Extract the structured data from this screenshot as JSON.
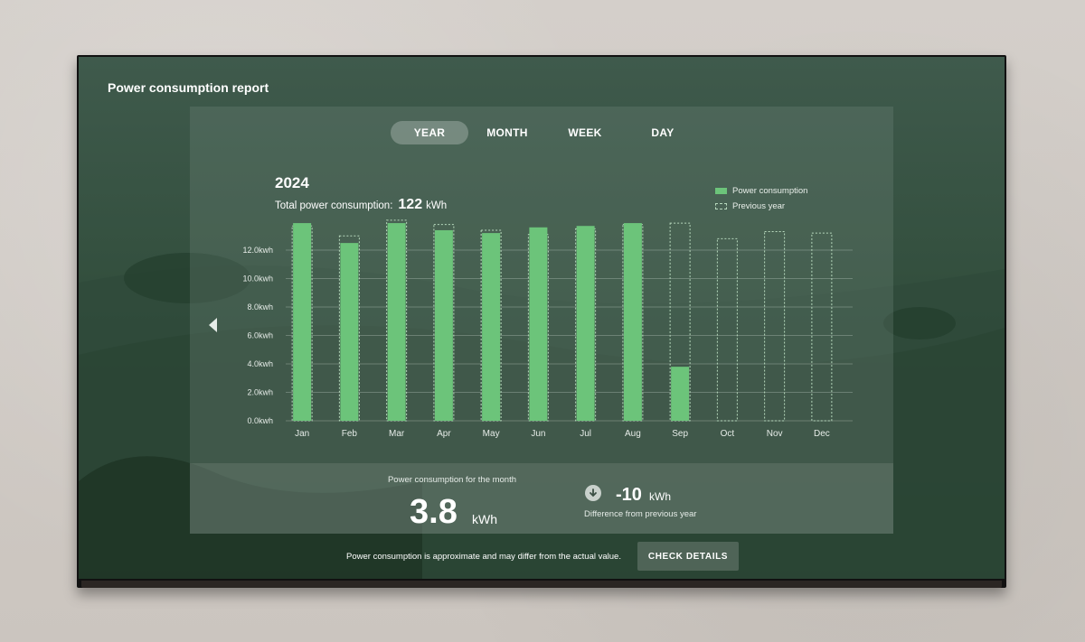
{
  "screen_title": "Power consumption report",
  "tabs": [
    {
      "label": "YEAR",
      "active": true
    },
    {
      "label": "MONTH",
      "active": false
    },
    {
      "label": "WEEK",
      "active": false
    },
    {
      "label": "DAY",
      "active": false
    }
  ],
  "period": {
    "year": "2024",
    "total_label": "Total power consumption:",
    "total_value": "122",
    "total_unit": "kWh"
  },
  "legend": {
    "current": "Power consumption",
    "previous": "Previous year"
  },
  "colors": {
    "bar": "#6cc47a",
    "previous_outline": "#b7d9bd",
    "grid": "rgba(220,230,224,0.28)"
  },
  "chart_data": {
    "type": "bar",
    "categories": [
      "Jan",
      "Feb",
      "Mar",
      "Apr",
      "May",
      "Jun",
      "Jul",
      "Aug",
      "Sep",
      "Oct",
      "Nov",
      "Dec"
    ],
    "series": [
      {
        "name": "Power consumption",
        "values": [
          13.9,
          12.5,
          13.9,
          13.4,
          13.2,
          13.6,
          13.7,
          13.9,
          3.8,
          null,
          null,
          null
        ]
      },
      {
        "name": "Previous year",
        "values": [
          13.7,
          13.0,
          14.1,
          13.8,
          13.4,
          13.1,
          13.5,
          13.8,
          13.9,
          12.8,
          13.3,
          13.2
        ]
      }
    ],
    "yticks": [
      "0.0kwh",
      "2.0kwh",
      "4.0kwh",
      "6.0kwh",
      "8.0kwh",
      "10.0kwh",
      "12.0kwh"
    ],
    "ylim": [
      0,
      12
    ],
    "grid": true,
    "legend_position": "top-right"
  },
  "month_summary": {
    "label": "Power consumption for the month",
    "value": "3.8",
    "unit": "kWh",
    "diff_value": "-10",
    "diff_unit": "kWh",
    "diff_label": "Difference from previous year"
  },
  "footer": {
    "note": "Power consumption is approximate and may differ from the actual value.",
    "button": "CHECK DETAILS"
  },
  "icons": {
    "prev": "chevron-left-icon",
    "diff": "arrow-down-circle-icon"
  }
}
